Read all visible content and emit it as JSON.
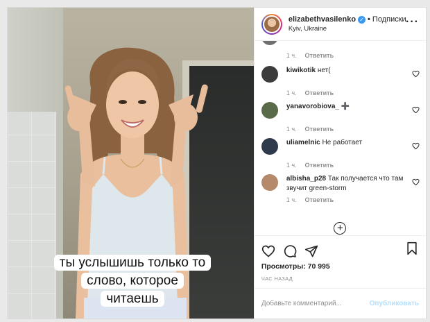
{
  "post": {
    "username": "elizabethvasilenko",
    "verified_icon": "verified-badge-icon",
    "dot": "•",
    "follow_label": "Подписки",
    "location": "Kyiv, Ukraine",
    "more_icon": "more-options-icon"
  },
  "media": {
    "caption_lines": [
      "ты услышишь только то",
      "слово, которое",
      "читаешь"
    ]
  },
  "comments": [
    {
      "username": "",
      "text": "",
      "time": "1 ч.",
      "reply": "Ответить",
      "avatar_color": "#6f6f6f"
    },
    {
      "username": "kiwikotik",
      "text": "нет(",
      "time": "1 ч.",
      "reply": "Ответить",
      "avatar_color": "#3c3c3c"
    },
    {
      "username": "yanavorobiova_",
      "text": "➕",
      "time": "1 ч.",
      "reply": "Ответить",
      "avatar_color": "#5a6b4a"
    },
    {
      "username": "uliamelnic",
      "text": "Не работает",
      "time": "1 ч.",
      "reply": "Ответить",
      "avatar_color": "#2f3a4c"
    },
    {
      "username": "albisha_p28",
      "text": "Так получается что там звучит green-storm",
      "time": "1 ч.",
      "reply": "Ответить",
      "avatar_color": "#b58a6a"
    }
  ],
  "load_more_icon": "plus-circle-icon",
  "actions": {
    "like_icon": "heart-icon",
    "comment_icon": "comment-icon",
    "share_icon": "share-icon",
    "save_icon": "bookmark-icon"
  },
  "stats": {
    "views": "Просмотры: 70 995",
    "timestamp": "ЧАС НАЗАД"
  },
  "composer": {
    "placeholder": "Добавьте комментарий...",
    "post_label": "Опубликовать"
  },
  "colors": {
    "link": "#3897f0",
    "post_disabled": "#b2dffc",
    "muted": "#8e8e8e"
  }
}
